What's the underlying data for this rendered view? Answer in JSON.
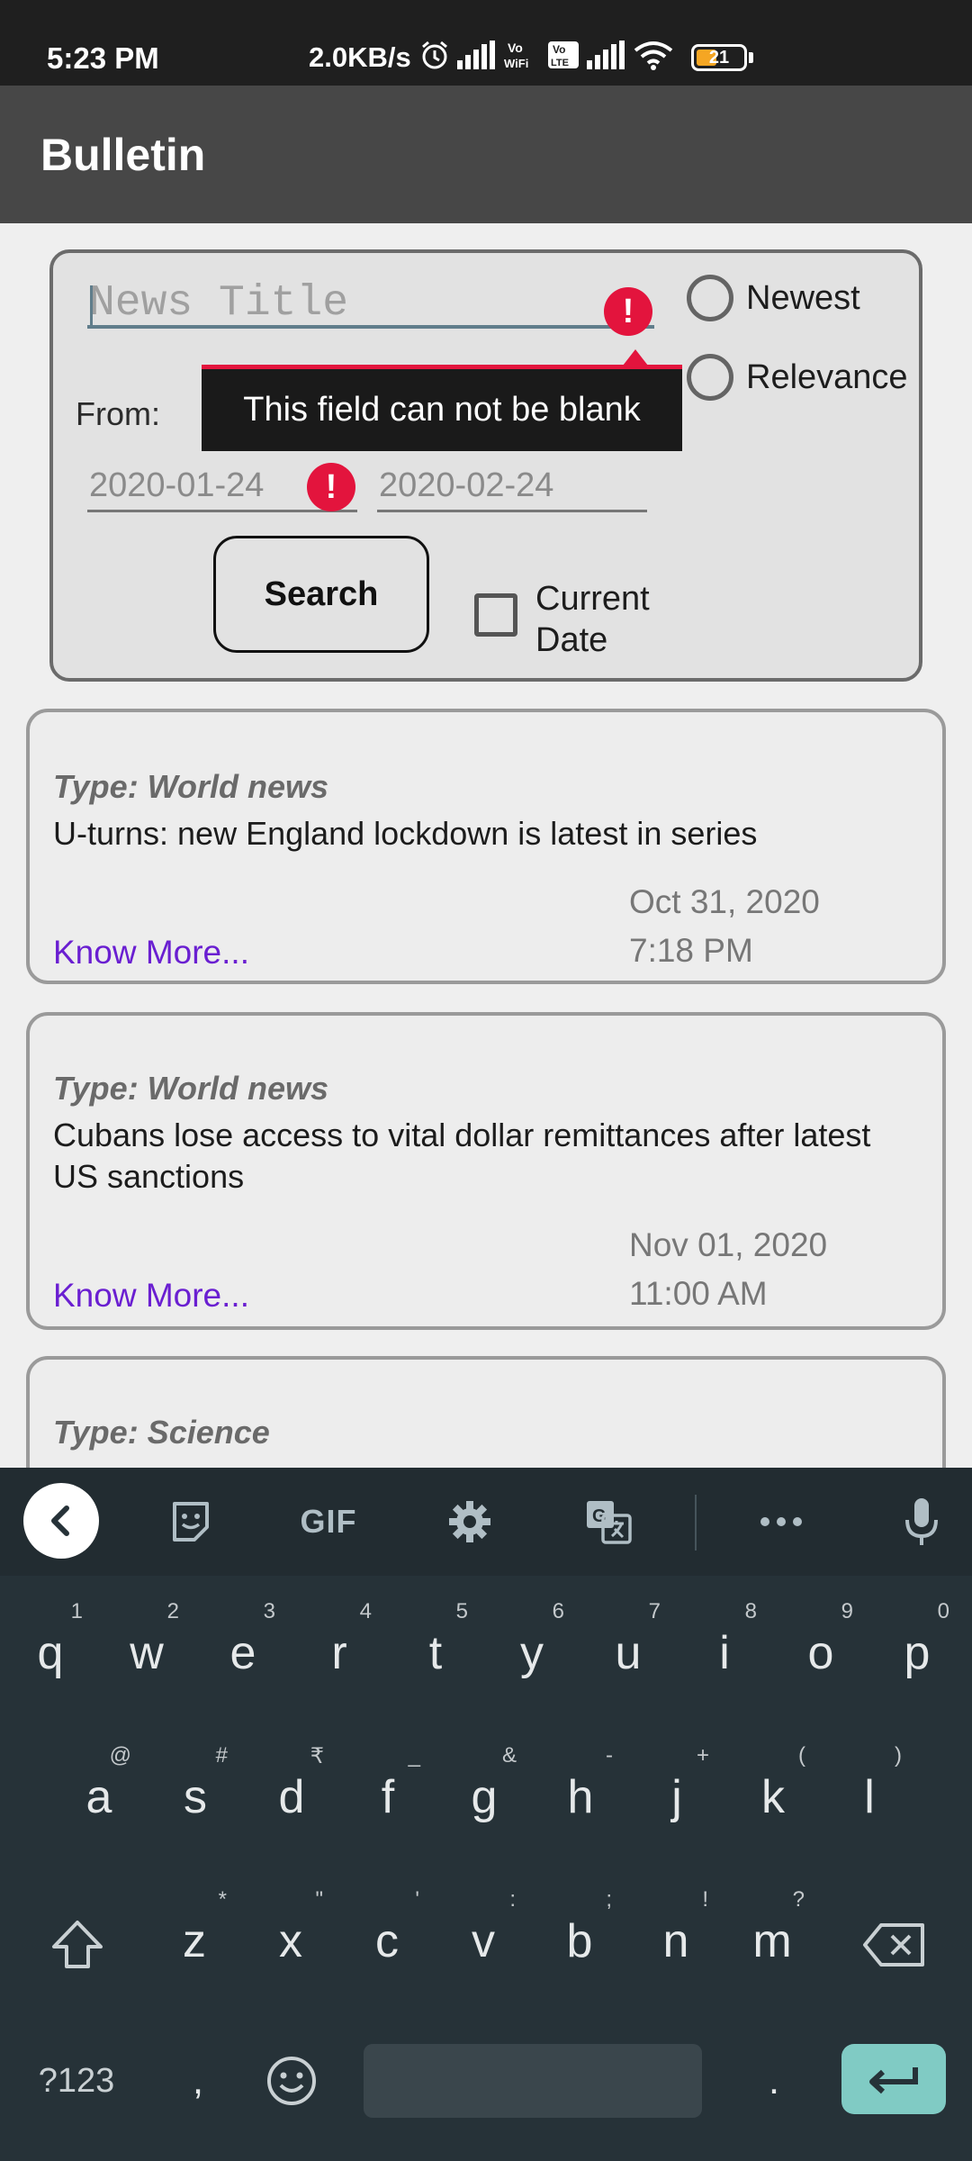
{
  "status_bar": {
    "time": "5:23 PM",
    "net_speed": "2.0KB/s",
    "battery": "21"
  },
  "app": {
    "title": "Bulletin"
  },
  "search": {
    "title_placeholder": "News Title",
    "sort_options": [
      "Newest",
      "Relevance"
    ],
    "from_label": "From:",
    "from_date": "2020-01-24",
    "to_date": "2020-02-24",
    "search_label": "Search",
    "current_date_label": "Current Date",
    "tooltip": "This field can not be blank"
  },
  "news": [
    {
      "type": "Type: World news",
      "title": "U-turns: new England lockdown is latest in series",
      "link": "Know More...",
      "date": "Oct 31, 2020",
      "time": "7:18 PM"
    },
    {
      "type": "Type: World news",
      "title": "Cubans lose access to vital dollar remittances after latest US sanctions",
      "link": "Know More...",
      "date": "Nov 01, 2020",
      "time": "11:00 AM"
    },
    {
      "type": "Type: Science"
    }
  ],
  "keyboard": {
    "toolbar": {
      "gif": "GIF"
    },
    "row1": [
      {
        "k": "q",
        "h": "1"
      },
      {
        "k": "w",
        "h": "2"
      },
      {
        "k": "e",
        "h": "3"
      },
      {
        "k": "r",
        "h": "4"
      },
      {
        "k": "t",
        "h": "5"
      },
      {
        "k": "y",
        "h": "6"
      },
      {
        "k": "u",
        "h": "7"
      },
      {
        "k": "i",
        "h": "8"
      },
      {
        "k": "o",
        "h": "9"
      },
      {
        "k": "p",
        "h": "0"
      }
    ],
    "row2": [
      {
        "k": "a",
        "h": "@"
      },
      {
        "k": "s",
        "h": "#"
      },
      {
        "k": "d",
        "h": "₹"
      },
      {
        "k": "f",
        "h": "_"
      },
      {
        "k": "g",
        "h": "&"
      },
      {
        "k": "h",
        "h": "-"
      },
      {
        "k": "j",
        "h": "+"
      },
      {
        "k": "k",
        "h": "("
      },
      {
        "k": "l",
        "h": ")"
      }
    ],
    "row3": [
      {
        "k": "z",
        "h": "*"
      },
      {
        "k": "x",
        "h": "\""
      },
      {
        "k": "c",
        "h": "'"
      },
      {
        "k": "v",
        "h": ":"
      },
      {
        "k": "b",
        "h": ";"
      },
      {
        "k": "n",
        "h": "!"
      },
      {
        "k": "m",
        "h": "?"
      }
    ],
    "symbols_label": "?123",
    "comma": ",",
    "period": "."
  }
}
